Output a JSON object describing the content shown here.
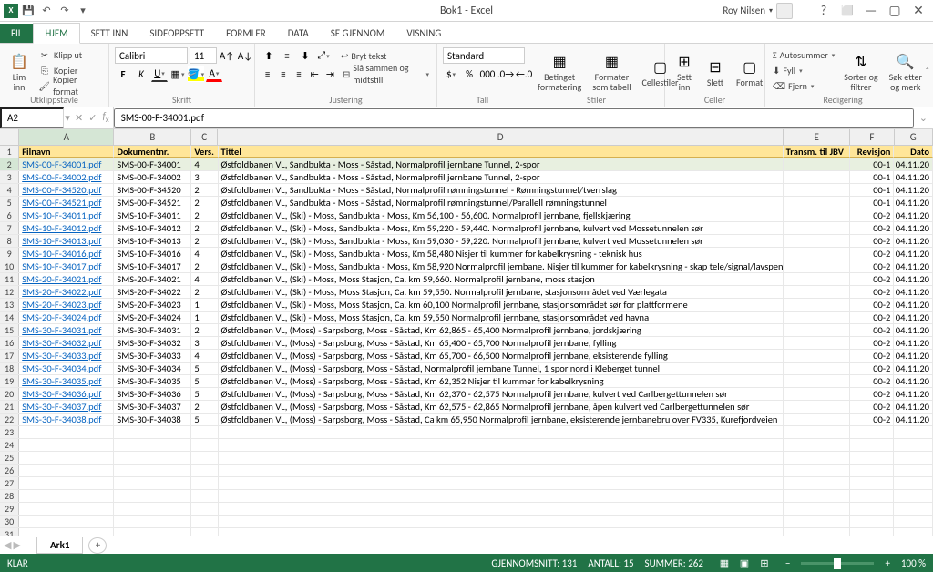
{
  "app": {
    "title": "Bok1 - Excel",
    "user": "Roy Nilsen"
  },
  "qat": {
    "save": "💾",
    "undo": "↶",
    "redo": "↷"
  },
  "tabs": [
    "FIL",
    "HJEM",
    "SETT INN",
    "SIDEOPPSETT",
    "FORMLER",
    "DATA",
    "SE GJENNOM",
    "VISNING"
  ],
  "ribbon": {
    "clipboard": {
      "label": "Utklippstavle",
      "paste": "Lim\ninn",
      "cut": "Klipp ut",
      "copy": "Kopier",
      "format_painter": "Kopier format"
    },
    "font": {
      "label": "Skrift",
      "name": "Calibri",
      "size": "11"
    },
    "alignment": {
      "label": "Justering",
      "wrap": "Bryt tekst",
      "merge": "Slå sammen og midtstill"
    },
    "number": {
      "label": "Tall",
      "format": "Standard"
    },
    "styles": {
      "label": "Stiler",
      "conditional": "Betinget\nformatering",
      "table": "Formater\nsom tabell",
      "cell": "Cellestiler"
    },
    "cells": {
      "label": "Celler",
      "insert": "Sett\ninn",
      "delete": "Slett",
      "format": "Format"
    },
    "editing": {
      "label": "Redigering",
      "sum": "Autosummer",
      "fill": "Fyll",
      "clear": "Fjern",
      "sort": "Sorter og\nfiltrer",
      "find": "Søk etter\nog merk"
    }
  },
  "formula": {
    "name_box": "A2",
    "value": "SMS-00-F-34001.pdf"
  },
  "columns": [
    "A",
    "B",
    "C",
    "D",
    "E",
    "F",
    "G"
  ],
  "headers": {
    "a": "Filnavn",
    "b": "Dokumentnr.",
    "c": "Vers.",
    "d": "Tittel",
    "e": "Transm. til JBV",
    "f": "Revisjon",
    "g": "Dato"
  },
  "rows": [
    {
      "a": "SMS-00-F-34001.pdf",
      "b": "SMS-00-F-34001",
      "c": "4",
      "d": "Østfoldbanen VL, Sandbukta - Moss - Såstad,  Normalprofil jernbane Tunnel, 2-spor",
      "e": "",
      "f": "00-1",
      "g": "04.11.20"
    },
    {
      "a": "SMS-00-F-34002.pdf",
      "b": "SMS-00-F-34002",
      "c": "3",
      "d": "Østfoldbanen VL, Sandbukta - Moss - Såstad,  Normalprofil jernbane Tunnel, 2-spor",
      "e": "",
      "f": "00-1",
      "g": "04.11.20"
    },
    {
      "a": "SMS-00-F-34520.pdf",
      "b": "SMS-00-F-34520",
      "c": "2",
      "d": "Østfoldbanen VL, Sandbukta - Moss - Såstad,  Normalprofil rømningstunnel - Rømningstunnel/tverrslag",
      "e": "",
      "f": "00-1",
      "g": "04.11.20"
    },
    {
      "a": "SMS-00-F-34521.pdf",
      "b": "SMS-00-F-34521",
      "c": "2",
      "d": "Østfoldbanen VL, Sandbukta - Moss - Såstad,  Normalprofil rømningstunnel/Parallell rømningstunnel",
      "e": "",
      "f": "00-1",
      "g": "04.11.20"
    },
    {
      "a": "SMS-10-F-34011.pdf",
      "b": "SMS-10-F-34011",
      "c": "2",
      "d": "Østfoldbanen VL, (Ski)  - Moss, Sandbukta - Moss,  Km 56,100 - 56,600. Normalprofil jernbane, fjellskjæring",
      "e": "",
      "f": "00-2",
      "g": "04.11.20"
    },
    {
      "a": "SMS-10-F-34012.pdf",
      "b": "SMS-10-F-34012",
      "c": "2",
      "d": "Østfoldbanen VL, (Ski)  - Moss, Sandbukta - Moss,  Km 59,220 - 59,440. Normalprofil jernbane, kulvert ved Mossetunnelen sør",
      "e": "",
      "f": "00-2",
      "g": "04.11.20"
    },
    {
      "a": "SMS-10-F-34013.pdf",
      "b": "SMS-10-F-34013",
      "c": "2",
      "d": "Østfoldbanen VL, (Ski)  - Moss, Sandbukta - Moss,  Km 59,030 - 59,220. Normalprofil jernbane, kulvert ved Mossetunnelen sør",
      "e": "",
      "f": "00-2",
      "g": "04.11.20"
    },
    {
      "a": "SMS-10-F-34016.pdf",
      "b": "SMS-10-F-34016",
      "c": "4",
      "d": "Østfoldbanen VL, (Ski)  - Moss, Sandbukta - Moss,  Km 58,480 Nisjer til kummer for kabelkrysning - teknisk hus",
      "e": "",
      "f": "00-2",
      "g": "04.11.20"
    },
    {
      "a": "SMS-10-F-34017.pdf",
      "b": "SMS-10-F-34017",
      "c": "2",
      "d": "Østfoldbanen VL, (Ski)  - Moss, Sandbukta - Moss,  Km 58,920 Normalprofil jernbane. Nisjer til kummer for kabelkrysning - skap tele/signal/lavspent",
      "e": "",
      "f": "00-2",
      "g": "04.11.20"
    },
    {
      "a": "SMS-20-F-34021.pdf",
      "b": "SMS-20-F-34021",
      "c": "4",
      "d": "Østfoldbanen VL, (Ski)  - Moss, Moss Stasjon,  Ca. km 59,660. Normalprofil jernbane, moss stasjon",
      "e": "",
      "f": "00-2",
      "g": "04.11.20"
    },
    {
      "a": "SMS-20-F-34022.pdf",
      "b": "SMS-20-F-34022",
      "c": "2",
      "d": "Østfoldbanen VL, (Ski)  - Moss, Moss Stasjon,  Ca. km 59,550. Normalprofil jernbane, stasjonsområdet ved Værlegata",
      "e": "",
      "f": "00-2",
      "g": "04.11.20"
    },
    {
      "a": "SMS-20-F-34023.pdf",
      "b": "SMS-20-F-34023",
      "c": "1",
      "d": "Østfoldbanen VL, (Ski)  - Moss, Moss Stasjon,  Ca. km 60,100 Normalprofil jernbane, stasjonsområdet sør for plattformene",
      "e": "",
      "f": "00-2",
      "g": "04.11.20"
    },
    {
      "a": "SMS-20-F-34024.pdf",
      "b": "SMS-20-F-34024",
      "c": "1",
      "d": "Østfoldbanen VL, (Ski)  - Moss, Moss Stasjon,  Ca. km 59,550 Normalprofil jernbane, stasjonsområdet ved havna",
      "e": "",
      "f": "00-2",
      "g": "04.11.20"
    },
    {
      "a": "SMS-30-F-34031.pdf",
      "b": "SMS-30-F-34031",
      "c": "2",
      "d": "Østfoldbanen VL, (Moss) - Sarpsborg, Moss - Såstad,  Km 62,865 - 65,400 Normalprofil jernbane, jordskjæring",
      "e": "",
      "f": "00-2",
      "g": "04.11.20"
    },
    {
      "a": "SMS-30-F-34032.pdf",
      "b": "SMS-30-F-34032",
      "c": "3",
      "d": "Østfoldbanen VL, (Moss) - Sarpsborg, Moss - Såstad,  Km 65,400 - 65,700 Normalprofil jernbane, fylling",
      "e": "",
      "f": "00-2",
      "g": "04.11.20"
    },
    {
      "a": "SMS-30-F-34033.pdf",
      "b": "SMS-30-F-34033",
      "c": "4",
      "d": "Østfoldbanen VL, (Moss) - Sarpsborg, Moss - Såstad,  Km 65,700  - 66,500 Normalprofil jernbane, eksisterende fylling",
      "e": "",
      "f": "00-2",
      "g": "04.11.20"
    },
    {
      "a": "SMS-30-F-34034.pdf",
      "b": "SMS-30-F-34034",
      "c": "5",
      "d": "Østfoldbanen VL, (Moss) - Sarpsborg, Moss - Såstad,  Normalprofil jernbane Tunnel, 1 spor nord i Kleberget tunnel",
      "e": "",
      "f": "00-2",
      "g": "04.11.20"
    },
    {
      "a": "SMS-30-F-34035.pdf",
      "b": "SMS-30-F-34035",
      "c": "5",
      "d": "Østfoldbanen VL, (Moss) - Sarpsborg, Moss - Såstad,  Km 62,352 Nisjer til kummer for kabelkrysning",
      "e": "",
      "f": "00-2",
      "g": "04.11.20"
    },
    {
      "a": "SMS-30-F-34036.pdf",
      "b": "SMS-30-F-34036",
      "c": "5",
      "d": "Østfoldbanen VL, (Moss) - Sarpsborg, Moss - Såstad,  Km 62,370 - 62,575 Normalprofil jernbane, kulvert ved Carlbergettunnelen sør",
      "e": "",
      "f": "00-2",
      "g": "04.11.20"
    },
    {
      "a": "SMS-30-F-34037.pdf",
      "b": "SMS-30-F-34037",
      "c": "2",
      "d": "Østfoldbanen VL, (Moss) - Sarpsborg, Moss - Såstad,  Km 62,575 - 62,865 Normalprofil jernbane, åpen kulvert ved Carlbergettunnelen sør",
      "e": "",
      "f": "00-2",
      "g": "04.11.20"
    },
    {
      "a": "SMS-30-F-34038.pdf",
      "b": "SMS-30-F-34038",
      "c": "5",
      "d": "Østfoldbanen VL, (Moss) - Sarpsborg, Moss - Såstad,  Ca km 65,950 Normalprofil jernbane, eksisterende jernbanebru over FV335, Kurefjordveien",
      "e": "",
      "f": "00-2",
      "g": "04.11.20"
    }
  ],
  "sheet": {
    "name": "Ark1"
  },
  "status": {
    "ready": "KLAR",
    "avg": "GJENNOMSNITT: 131",
    "count": "ANTALL: 15",
    "sum": "SUMMER: 262",
    "zoom": "100 %"
  }
}
